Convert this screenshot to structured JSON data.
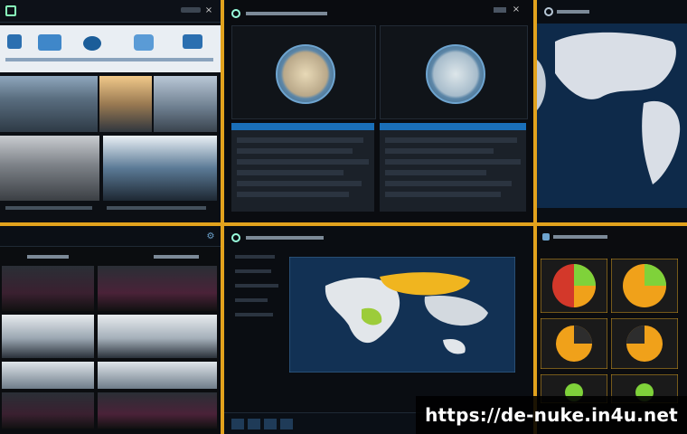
{
  "watermark": {
    "url": "https://de-nuke.in4u.net"
  },
  "colors": {
    "frame_gold": "#d39a1c",
    "accent_blue": "#1a6fb8",
    "map_ocean": "#0e2a4a",
    "map_land": "#d9dee6",
    "chart_orange": "#f0a11a",
    "chart_green": "#7fd23a",
    "chart_red": "#d3382a"
  },
  "icons": {
    "top_left_logo": "app-logo-icon",
    "close": "close-icon",
    "window_controls": "window-controls-icon",
    "gear": "gear-icon",
    "search": "search-icon",
    "globe": "globe-icon"
  }
}
